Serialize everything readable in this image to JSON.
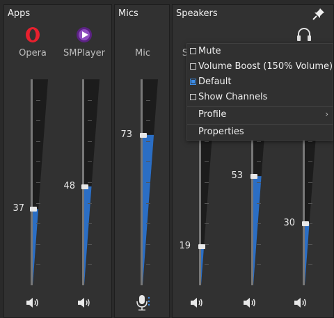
{
  "panels": {
    "apps_title": "Apps",
    "mics_title": "Mics",
    "speakers_title": "Speakers"
  },
  "channels": [
    {
      "id": "opera",
      "label": "Opera",
      "value": "37",
      "level": 0.37
    },
    {
      "id": "smplayer",
      "label": "SMPlayer",
      "value": "48",
      "level": 0.48
    },
    {
      "id": "mic",
      "label": "Mic",
      "value": "73",
      "level": 0.73
    },
    {
      "id": "speaker-1",
      "label": "S",
      "value": "19",
      "level": 0.19
    },
    {
      "id": "speaker-2",
      "label": "",
      "value": "53",
      "level": 0.53
    },
    {
      "id": "speaker-3",
      "label": "",
      "value": "30",
      "level": 0.3
    }
  ],
  "context_menu": {
    "mute": "Mute",
    "mute_checked": false,
    "volume_boost": "Volume Boost (150% Volume)",
    "volume_boost_checked": false,
    "default": "Default",
    "default_checked": true,
    "show_channels": "Show Channels",
    "show_channels_checked": false,
    "profile": "Profile",
    "profile_arrow": "›",
    "properties": "Properties"
  },
  "colors": {
    "accent": "#2b6ec4",
    "opera_red": "#e8202e",
    "smplayer_purple": "#6a2d91"
  },
  "icons": {
    "opera": "opera-logo-icon",
    "smplayer": "smplayer-logo-icon",
    "headphones": "headphones-icon",
    "pin": "pin-icon",
    "speaker": "speaker-volume-icon",
    "mic": "microphone-icon"
  }
}
